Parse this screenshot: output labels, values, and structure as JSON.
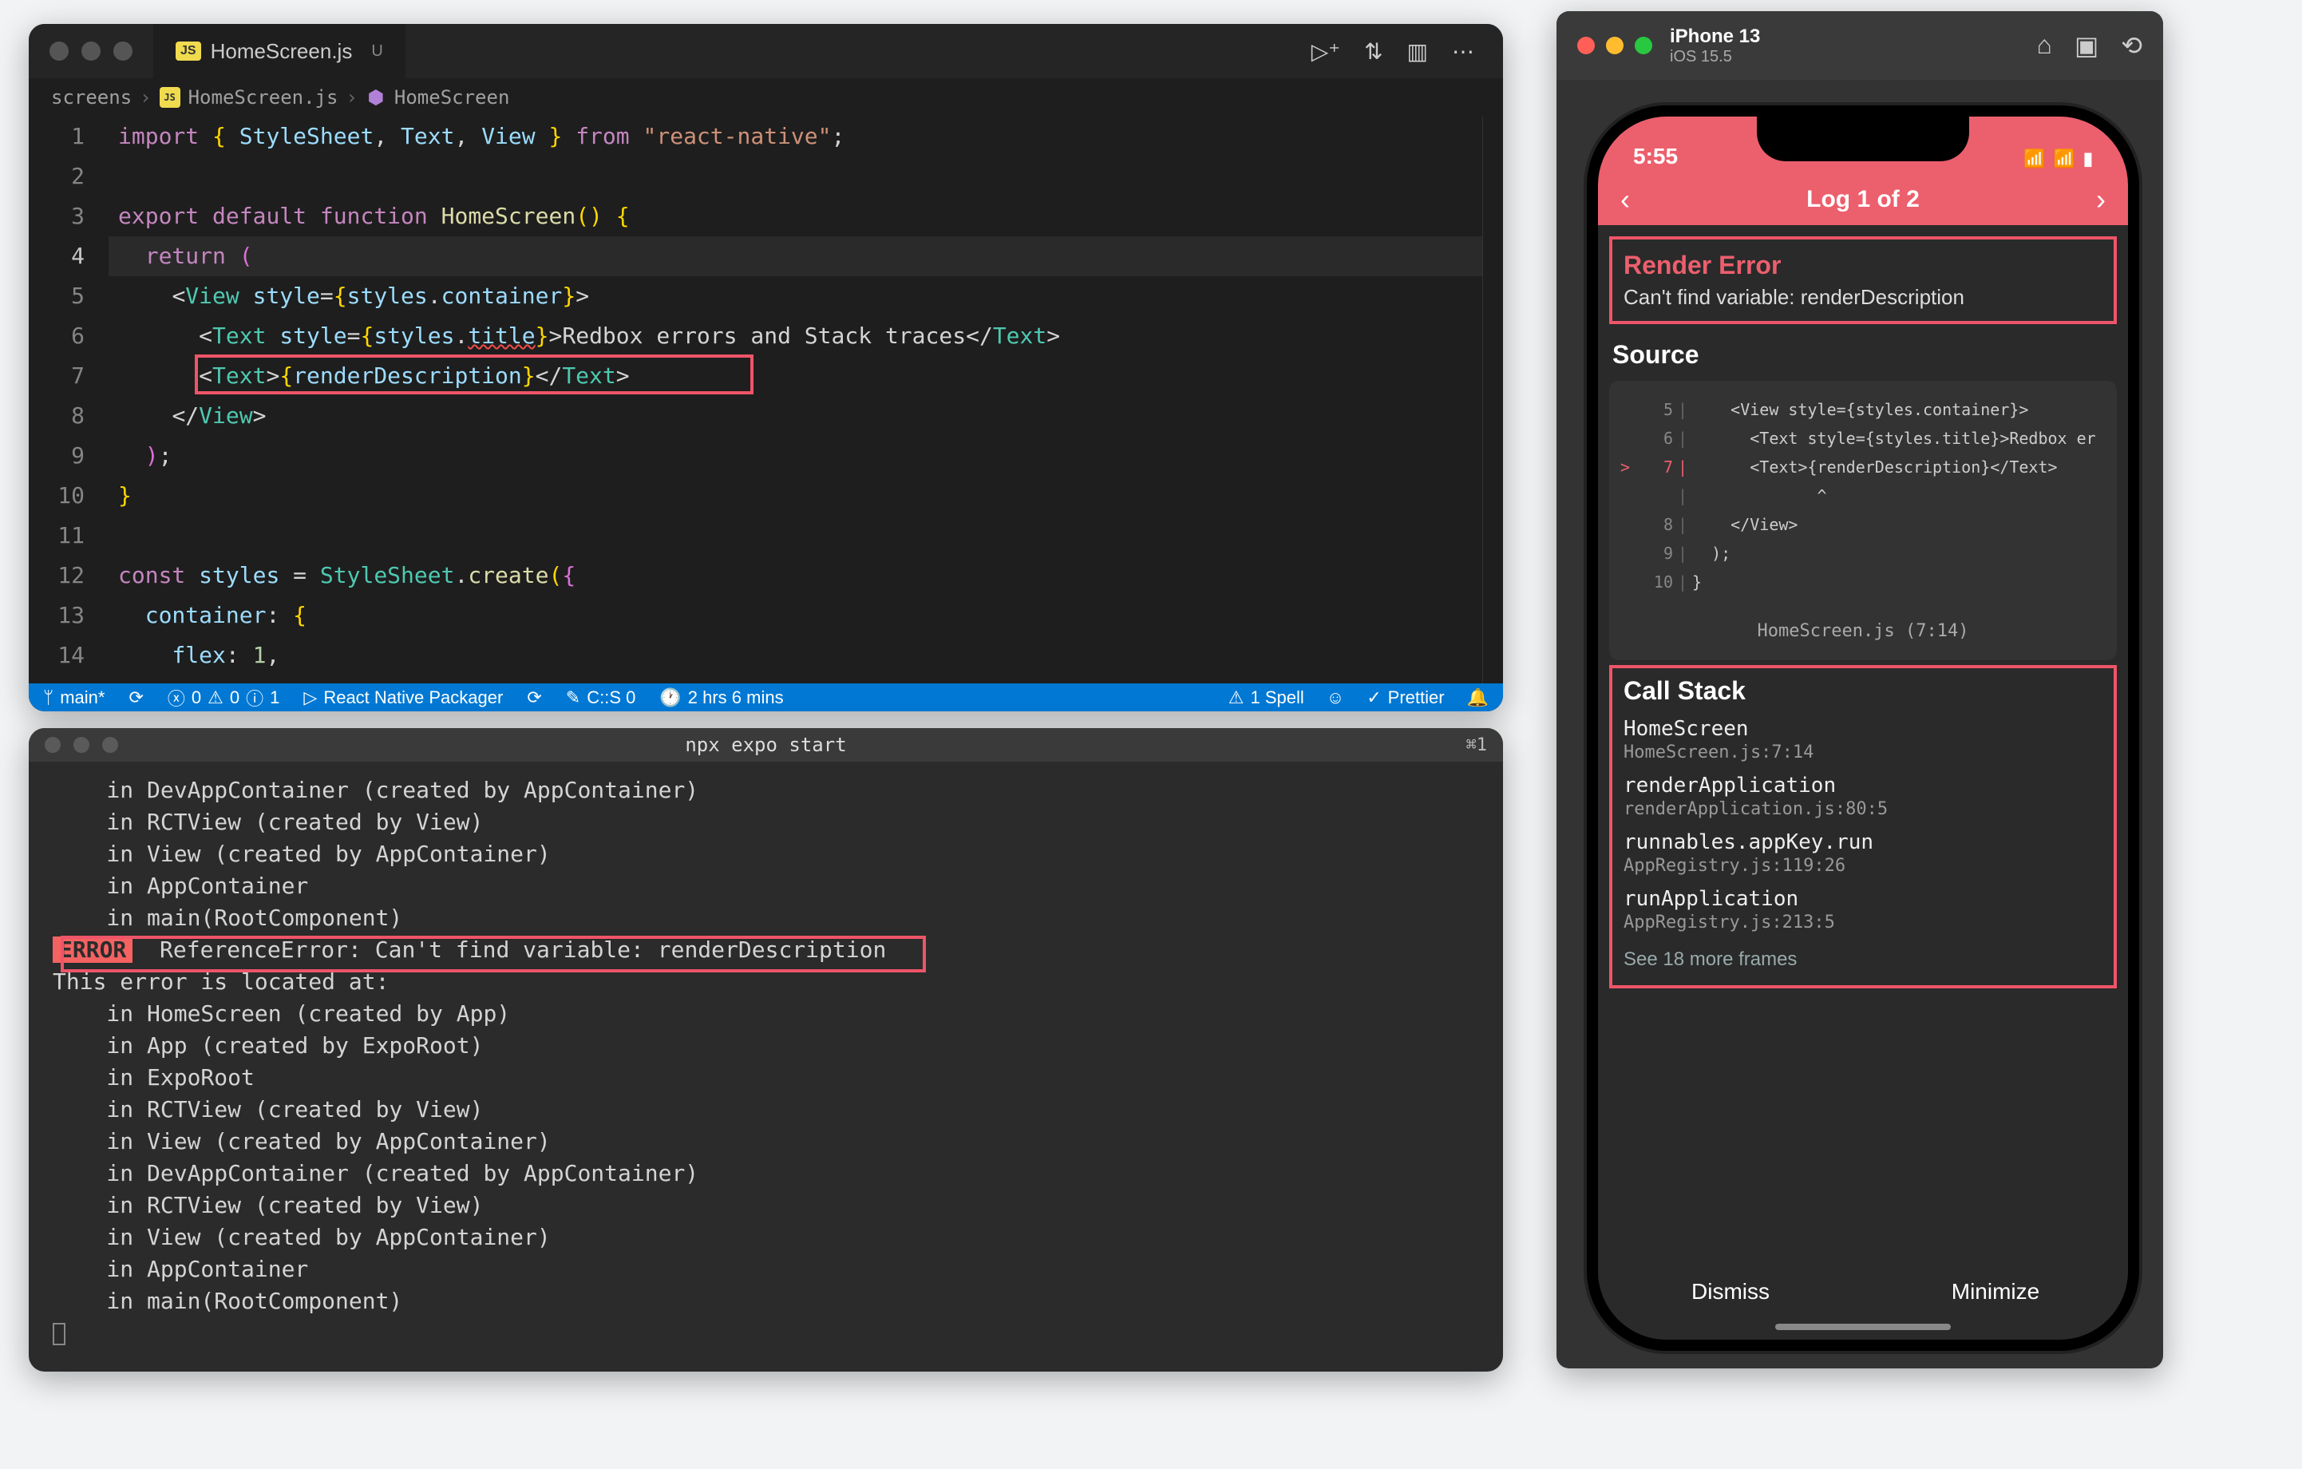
{
  "vscode": {
    "tab": {
      "icon": "JS",
      "filename": "HomeScreen.js",
      "dirty": "U"
    },
    "breadcrumb": [
      "screens",
      "HomeScreen.js",
      "HomeScreen"
    ],
    "code_lines": {
      "1": "import { StyleSheet, Text, View } from \"react-native\";",
      "2": "",
      "3": "export default function HomeScreen() {",
      "4": "  return (",
      "5": "    <View style={styles.container}>",
      "6": "      <Text style={styles.title}>Redbox errors and Stack traces</Text>",
      "7": "      <Text>{renderDescription}</Text>",
      "8": "    </View>",
      "9": "  );",
      "10": "}",
      "11": "",
      "12": "const styles = StyleSheet.create({",
      "13": "  container: {",
      "14": "    flex: 1,"
    },
    "statusbar": {
      "branch": "main*",
      "errors": "0",
      "warnings": "0",
      "info": "1",
      "packager": "React Native Packager",
      "profile": "C::S 0",
      "time": "2 hrs 6 mins",
      "spell": "1 Spell",
      "prettier": "Prettier"
    }
  },
  "terminal": {
    "title": "npx expo start",
    "shortcut": "⌘1",
    "lines_pre": [
      "    in DevAppContainer (created by AppContainer)",
      "    in RCTView (created by View)",
      "    in View (created by AppContainer)",
      "    in AppContainer",
      "    in main(RootComponent)"
    ],
    "error_label": "ERROR",
    "error_msg": "ReferenceError: Can't find variable: renderDescription",
    "located": "This error is located at:",
    "lines_post": [
      "    in HomeScreen (created by App)",
      "    in App (created by ExpoRoot)",
      "    in ExpoRoot",
      "    in RCTView (created by View)",
      "    in View (created by AppContainer)",
      "    in DevAppContainer (created by AppContainer)",
      "    in RCTView (created by View)",
      "    in View (created by AppContainer)",
      "    in AppContainer",
      "    in main(RootComponent)"
    ]
  },
  "simulator": {
    "device": "iPhone 13",
    "os": "iOS 15.5",
    "clock": "5:55",
    "log_nav": "Log 1 of 2",
    "error_title": "Render Error",
    "error_msg": "Can't find variable: renderDescription",
    "source_title": "Source",
    "source_lines": [
      {
        "n": "5",
        "code": "    <View style={styles.container}>"
      },
      {
        "n": "6",
        "code": "      <Text style={styles.title}>Redbox er"
      },
      {
        "n": "7",
        "code": "      <Text>{renderDescription}</Text>",
        "cur": true
      },
      {
        "n": "",
        "code": "             ^",
        "caret": true
      },
      {
        "n": "8",
        "code": "    </View>"
      },
      {
        "n": "9",
        "code": "  );"
      },
      {
        "n": "10",
        "code": "}"
      }
    ],
    "source_file": "HomeScreen.js (7:14)",
    "callstack_title": "Call Stack",
    "frames": [
      {
        "fn": "HomeScreen",
        "loc": "HomeScreen.js:7:14"
      },
      {
        "fn": "renderApplication",
        "loc": "renderApplication.js:80:5"
      },
      {
        "fn": "runnables.appKey.run",
        "loc": "AppRegistry.js:119:26"
      },
      {
        "fn": "runApplication",
        "loc": "AppRegistry.js:213:5"
      }
    ],
    "more_frames": "See 18 more frames",
    "dismiss": "Dismiss",
    "minimize": "Minimize"
  }
}
